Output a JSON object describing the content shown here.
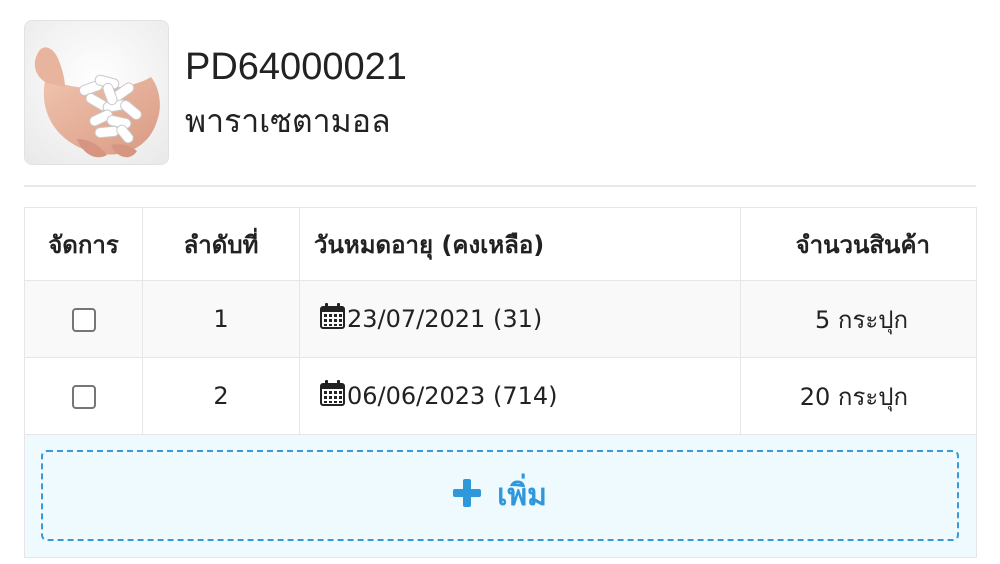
{
  "product": {
    "code": "PD64000021",
    "name": "พาราเซตามอล",
    "image_icon": "hand-holding-pills-photo"
  },
  "table": {
    "headers": {
      "manage": "จัดการ",
      "index": "ลำดับที่",
      "expiry": "วันหมดอายุ (คงเหลือ)",
      "quantity": "จำนวนสินค้า"
    },
    "rows": [
      {
        "index": "1",
        "expiry": "23/07/2021 (31)",
        "quantity": "5 กระปุก",
        "checked": false
      },
      {
        "index": "2",
        "expiry": "06/06/2023 (714)",
        "quantity": "20 กระปุก",
        "checked": false
      }
    ],
    "calendar_icon": "calendar-icon"
  },
  "add_button": {
    "label": "เพิ่ม",
    "icon": "plus-icon"
  },
  "colors": {
    "accent": "#2f98db",
    "add_background": "#eefafd",
    "row_stripe": "#f9f9f9",
    "border": "#e6e6e6"
  }
}
